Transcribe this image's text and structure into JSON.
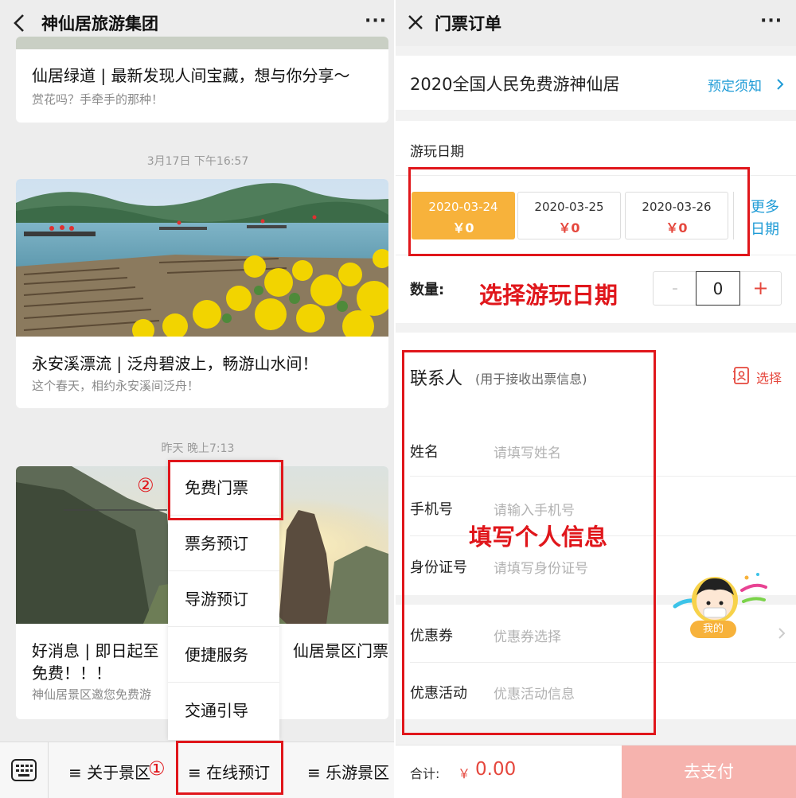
{
  "left": {
    "header": {
      "title": "神仙居旅游集团",
      "more": "···"
    },
    "articles": [
      {
        "title": "仙居绿道 | 最新发现人间宝藏，想与你分享～",
        "sub": "赏花吗？手牵手的那种！"
      },
      {
        "title": "永安溪漂流 | 泛舟碧波上，畅游山水间！",
        "sub": "这个春天，相约永安溪间泛舟！"
      },
      {
        "title_a": "好消息 | 即日起至",
        "title_b": "仙居景区门票",
        "title_c": "免费！！！",
        "sub": "神仙居景区邀您免费游"
      }
    ],
    "timestamps": [
      "3月17日 下午16:57",
      "昨天 晚上7:13"
    ],
    "menu_items": [
      "免费门票",
      "票务预订",
      "导游预订",
      "便捷服务",
      "交通引导"
    ],
    "bottom_nav": [
      "≡ 关于景区",
      "≡ 在线预订",
      "≡ 乐游景区"
    ],
    "markers": [
      "①",
      "②"
    ]
  },
  "right": {
    "header": {
      "title": "门票订单",
      "more": "···"
    },
    "product": {
      "name": "2020全国人民免费游神仙居",
      "notice": "预定须知"
    },
    "date_label": "游玩日期",
    "dates": [
      {
        "date": "2020-03-24",
        "price": "￥0",
        "selected": true
      },
      {
        "date": "2020-03-25",
        "price": "￥0",
        "selected": false
      },
      {
        "date": "2020-03-26",
        "price": "￥0",
        "selected": false
      }
    ],
    "more_dates": [
      "更多",
      "日期"
    ],
    "quantity": {
      "label": "数量:",
      "minus": "-",
      "value": "0",
      "plus": "+"
    },
    "annotation_date": "选择游玩日期",
    "contact": {
      "title": "联系人",
      "hint": "(用于接收出票信息)",
      "select": "选择"
    },
    "fields": [
      {
        "label": "姓名",
        "placeholder": "请填写姓名"
      },
      {
        "label": "手机号",
        "placeholder": "请输入手机号"
      },
      {
        "label": "身份证号",
        "placeholder": "请填写身份证号"
      }
    ],
    "annotation_info": "填写个人信息",
    "coupon": {
      "label": "优惠券",
      "placeholder": "优惠券选择"
    },
    "promo": {
      "label": "优惠活动",
      "placeholder": "优惠活动信息"
    },
    "mascot": "我的",
    "footer": {
      "total_label": "合计:",
      "currency": "￥",
      "amount": "0.00",
      "pay": "去支付"
    }
  },
  "colors": {
    "accent": "#f7b23b",
    "annotation_red": "#e0161b",
    "pay_button": "#f6b3ae",
    "price_red": "#e5473d",
    "link_blue": "#1e9bd6"
  }
}
